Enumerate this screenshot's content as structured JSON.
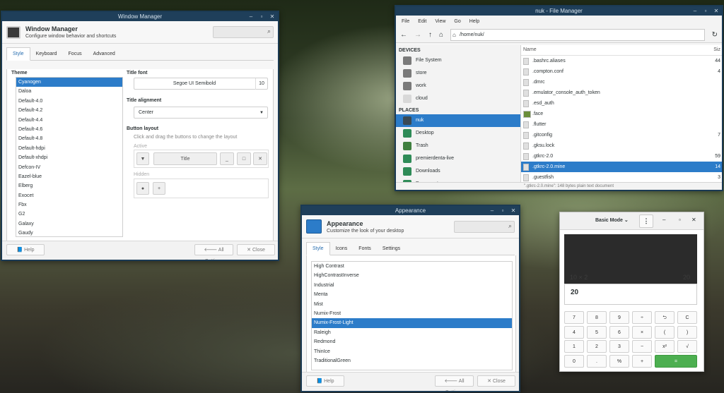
{
  "window_manager": {
    "title": "Window Manager",
    "header_title": "Window Manager",
    "header_subtitle": "Configure window behavior and shortcuts",
    "tabs": [
      "Style",
      "Keyboard",
      "Focus",
      "Advanced"
    ],
    "theme_label": "Theme",
    "themes": [
      "Cyanogen",
      "Daloa",
      "Default-4.0",
      "Default-4.2",
      "Default-4.4",
      "Default-4.6",
      "Default-4.8",
      "Default-hdpi",
      "Default-xhdpi",
      "Defcon-IV",
      "Eazel-blue",
      "Elberg",
      "Exocet",
      "Fbx",
      "G2",
      "Galaxy",
      "Gaudy"
    ],
    "selected_theme": "Cyanogen",
    "title_font_label": "Title font",
    "title_font_name": "Segoe UI Semibold",
    "title_font_size": "10",
    "title_alignment_label": "Title alignment",
    "title_alignment_value": "Center",
    "button_layout_label": "Button layout",
    "button_layout_hint": "Click and drag the buttons to change the layout",
    "active_label": "Active",
    "active_title": "Title",
    "active_buttons": [
      "_",
      "□",
      "✕"
    ],
    "hidden_label": "Hidden",
    "hidden_buttons": [
      "●",
      "+"
    ],
    "help_label": "Help",
    "all_settings_label": "All Settings",
    "close_label": "Close"
  },
  "file_manager": {
    "title": "nuk - File Manager",
    "menu": [
      "File",
      "Edit",
      "View",
      "Go",
      "Help"
    ],
    "path": "/home/nuk/",
    "devices_header": "DEVICES",
    "devices": [
      "File System",
      "store",
      "work",
      "cloud"
    ],
    "places_header": "PLACES",
    "places": [
      "nuk",
      "Desktop",
      "Trash",
      "premierdenta-live",
      "Downloads",
      "Documents"
    ],
    "selected_place": "nuk",
    "columns": {
      "name": "Name",
      "size": "Siz"
    },
    "files": [
      {
        "name": ".bashrc.aliases",
        "size": "44"
      },
      {
        "name": ".compton.conf",
        "size": "4"
      },
      {
        "name": ".dmrc",
        "size": ""
      },
      {
        "name": ".emulator_console_auth_token",
        "size": ""
      },
      {
        "name": ".esd_auth",
        "size": ""
      },
      {
        "name": ".face",
        "size": ""
      },
      {
        "name": ".flutter",
        "size": ""
      },
      {
        "name": ".gitconfig",
        "size": "7"
      },
      {
        "name": ".gksu.lock",
        "size": ""
      },
      {
        "name": ".gtkrc-2.0",
        "size": "59"
      },
      {
        "name": ".gtkrc-2.0.mine",
        "size": "14"
      },
      {
        "name": ".guestfish",
        "size": "3"
      }
    ],
    "selected_file": ".gtkrc-2.0.mine",
    "status": "\".gtkrc-2.0.mine\": 148 bytes plain text document"
  },
  "appearance": {
    "title": "Appearance",
    "header_title": "Appearance",
    "header_subtitle": "Customize the look of your desktop",
    "tabs": [
      "Style",
      "Icons",
      "Fonts",
      "Settings"
    ],
    "themes": [
      "High Contrast",
      "HighContrastInverse",
      "Industrial",
      "Menta",
      "Mist",
      "Numix-Frost",
      "Numix-Frost-Light",
      "Raleigh",
      "Redmond",
      "ThinIce",
      "TraditionalGreen"
    ],
    "selected_theme": "Numix-Frost-Light",
    "help_label": "Help",
    "all_settings_label": "All Settings",
    "close_label": "Close"
  },
  "calculator": {
    "mode_label": "Basic Mode",
    "history_left": "10 × 2",
    "history_right": "20",
    "entry": "20",
    "keys": [
      [
        "7",
        "8",
        "9",
        "÷",
        "⮌",
        "C"
      ],
      [
        "4",
        "5",
        "6",
        "×",
        "(",
        ")"
      ],
      [
        "1",
        "2",
        "3",
        "−",
        "x²",
        "√"
      ],
      [
        "0",
        ".",
        "%",
        "+",
        "="
      ]
    ],
    "equals_color": "#4caf50"
  },
  "colors": {
    "titlebar": "#1f3f5a",
    "selection": "#2c7cc9"
  }
}
